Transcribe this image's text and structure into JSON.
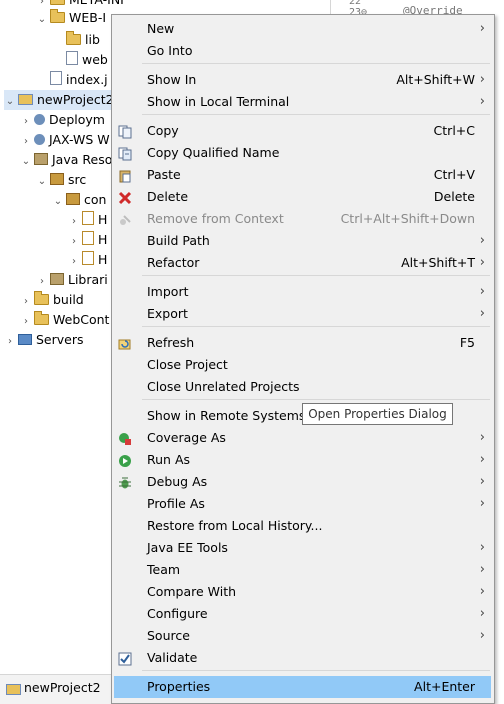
{
  "tree": {
    "items": [
      {
        "label": "META-INF",
        "arrow": "›",
        "icon": "folder"
      },
      {
        "label": "WEB-I",
        "arrow": "⌄",
        "icon": "folder"
      },
      {
        "label": "lib",
        "arrow": "",
        "icon": "folder"
      },
      {
        "label": "web",
        "arrow": "",
        "icon": "file"
      },
      {
        "label": "index.j",
        "arrow": "",
        "icon": "file"
      },
      {
        "label": "newProject2",
        "arrow": "⌄",
        "icon": "proj"
      },
      {
        "label": "Deploym",
        "arrow": "›",
        "icon": "gear"
      },
      {
        "label": "JAX-WS W",
        "arrow": "›",
        "icon": "gear"
      },
      {
        "label": "Java Reso",
        "arrow": "⌄",
        "icon": "lib"
      },
      {
        "label": "src",
        "arrow": "⌄",
        "icon": "pkg"
      },
      {
        "label": "con",
        "arrow": "⌄",
        "icon": "pkg"
      },
      {
        "label": "H",
        "arrow": "›",
        "icon": "java"
      },
      {
        "label": "H",
        "arrow": "›",
        "icon": "java"
      },
      {
        "label": "H",
        "arrow": "›",
        "icon": "java"
      },
      {
        "label": "Librari",
        "arrow": "›",
        "icon": "lib"
      },
      {
        "label": "build",
        "arrow": "›",
        "icon": "folder"
      },
      {
        "label": "WebCont",
        "arrow": "›",
        "icon": "folder"
      },
      {
        "label": "Servers",
        "arrow": "›",
        "icon": "srv"
      }
    ]
  },
  "editor": {
    "line_numbers": "22\n23⊖",
    "code": "@Override"
  },
  "status": {
    "project": "newProject2"
  },
  "menu": {
    "items": [
      {
        "label": "New",
        "shortcut": "",
        "submenu": true,
        "icon": "",
        "disabled": false
      },
      {
        "label": "Go Into",
        "shortcut": "",
        "submenu": false,
        "icon": "",
        "disabled": false
      },
      {
        "label": "Show In",
        "shortcut": "Alt+Shift+W",
        "submenu": true,
        "icon": "",
        "disabled": false
      },
      {
        "label": "Show in Local Terminal",
        "shortcut": "",
        "submenu": true,
        "icon": "",
        "disabled": false
      },
      {
        "label": "Copy",
        "shortcut": "Ctrl+C",
        "submenu": false,
        "icon": "copy-icon",
        "disabled": false
      },
      {
        "label": "Copy Qualified Name",
        "shortcut": "",
        "submenu": false,
        "icon": "copy-qualified-icon",
        "disabled": false
      },
      {
        "label": "Paste",
        "shortcut": "Ctrl+V",
        "submenu": false,
        "icon": "paste-icon",
        "disabled": false
      },
      {
        "label": "Delete",
        "shortcut": "Delete",
        "submenu": false,
        "icon": "delete-icon",
        "disabled": false
      },
      {
        "label": "Remove from Context",
        "shortcut": "Ctrl+Alt+Shift+Down",
        "submenu": false,
        "icon": "remove-context-icon",
        "disabled": true
      },
      {
        "label": "Build Path",
        "shortcut": "",
        "submenu": true,
        "icon": "",
        "disabled": false
      },
      {
        "label": "Refactor",
        "shortcut": "Alt+Shift+T",
        "submenu": true,
        "icon": "",
        "disabled": false
      },
      {
        "label": "Import",
        "shortcut": "",
        "submenu": true,
        "icon": "",
        "disabled": false
      },
      {
        "label": "Export",
        "shortcut": "",
        "submenu": true,
        "icon": "",
        "disabled": false
      },
      {
        "label": "Refresh",
        "shortcut": "F5",
        "submenu": false,
        "icon": "refresh-icon",
        "disabled": false
      },
      {
        "label": "Close Project",
        "shortcut": "",
        "submenu": false,
        "icon": "",
        "disabled": false
      },
      {
        "label": "Close Unrelated Projects",
        "shortcut": "",
        "submenu": false,
        "icon": "",
        "disabled": false
      },
      {
        "label": "Show in Remote Systems vi",
        "shortcut": "",
        "submenu": false,
        "icon": "",
        "disabled": false
      },
      {
        "label": "Coverage As",
        "shortcut": "",
        "submenu": true,
        "icon": "coverage-icon",
        "disabled": false
      },
      {
        "label": "Run As",
        "shortcut": "",
        "submenu": true,
        "icon": "run-icon",
        "disabled": false
      },
      {
        "label": "Debug As",
        "shortcut": "",
        "submenu": true,
        "icon": "debug-icon",
        "disabled": false
      },
      {
        "label": "Profile As",
        "shortcut": "",
        "submenu": true,
        "icon": "",
        "disabled": false
      },
      {
        "label": "Restore from Local History...",
        "shortcut": "",
        "submenu": false,
        "icon": "",
        "disabled": false
      },
      {
        "label": "Java EE Tools",
        "shortcut": "",
        "submenu": true,
        "icon": "",
        "disabled": false
      },
      {
        "label": "Team",
        "shortcut": "",
        "submenu": true,
        "icon": "",
        "disabled": false
      },
      {
        "label": "Compare With",
        "shortcut": "",
        "submenu": true,
        "icon": "",
        "disabled": false
      },
      {
        "label": "Configure",
        "shortcut": "",
        "submenu": true,
        "icon": "",
        "disabled": false
      },
      {
        "label": "Source",
        "shortcut": "",
        "submenu": true,
        "icon": "",
        "disabled": false
      },
      {
        "label": "Validate",
        "shortcut": "",
        "submenu": false,
        "icon": "checkbox-icon",
        "disabled": false
      },
      {
        "label": "Properties",
        "shortcut": "Alt+Enter",
        "submenu": false,
        "icon": "",
        "disabled": false,
        "highlighted": true
      }
    ]
  },
  "tooltip": {
    "text": "Open Properties Dialog"
  },
  "colors": {
    "menu_bg": "#f0f0f0",
    "highlight": "#91c9f7",
    "tree_selection": "#d9e7f7",
    "disabled_text": "#8a8a8a"
  }
}
